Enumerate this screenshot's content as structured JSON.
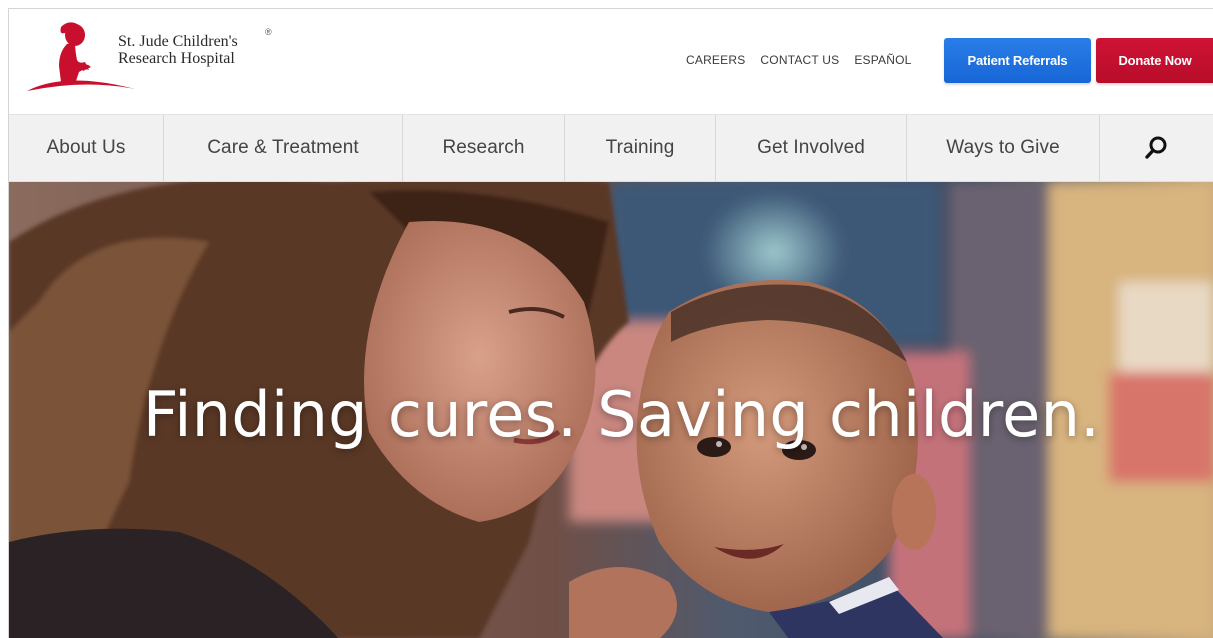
{
  "brand": {
    "line1": "St. Jude Children's",
    "line2": "Research Hospital",
    "registered_mark": "®",
    "color": "#c8102e"
  },
  "utility_nav": [
    {
      "label": "CAREERS"
    },
    {
      "label": "CONTACT US"
    },
    {
      "label": "ESPAÑOL"
    }
  ],
  "buttons": {
    "referrals_label": "Patient Referrals",
    "donate_label": "Donate Now",
    "referrals_color": "#1a73e8",
    "donate_color": "#c8102e"
  },
  "main_nav": [
    {
      "label": "About Us"
    },
    {
      "label": "Care & Treatment"
    },
    {
      "label": "Research"
    },
    {
      "label": "Training"
    },
    {
      "label": "Get Involved"
    },
    {
      "label": "Ways to Give"
    }
  ],
  "search": {
    "icon": "search-icon"
  },
  "hero": {
    "headline": "Finding cures. Saving children."
  }
}
